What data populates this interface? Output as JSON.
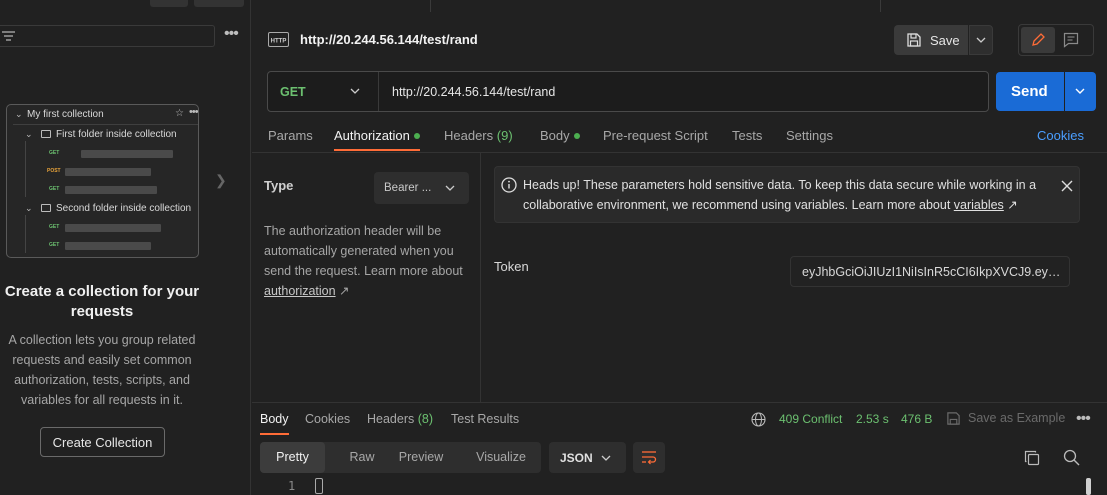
{
  "sidebar": {
    "preview": {
      "collection": "My first collection",
      "folders": [
        {
          "name": "First folder inside collection",
          "requests": [
            "GET",
            "POST",
            "GET"
          ]
        },
        {
          "name": "Second folder inside collection",
          "requests": [
            "GET",
            "GET"
          ]
        }
      ]
    },
    "title": "Create a collection for your requests",
    "description": "A collection lets you group related requests and easily set common authorization, tests, scripts, and variables for all requests in it.",
    "create_button": "Create Collection"
  },
  "request": {
    "title": "http://20.244.56.144/test/rand",
    "save_label": "Save",
    "method": "GET",
    "url": "http://20.244.56.144/test/rand",
    "send_label": "Send"
  },
  "request_tabs": {
    "params": "Params",
    "authorization": "Authorization",
    "headers": "Headers",
    "headers_count": "(9)",
    "body": "Body",
    "pre_request": "Pre-request Script",
    "tests": "Tests",
    "settings": "Settings",
    "cookies": "Cookies"
  },
  "auth": {
    "type_label": "Type",
    "type_value": "Bearer ...",
    "desc_prefix": "The authorization header will be automatically generated when you send the request. Learn more about ",
    "desc_link": "authorization",
    "desc_suffix": " ↗",
    "alert_text": "Heads up! These parameters hold sensitive data. To keep this data secure while working in a collaborative environment, we recommend using variables. Learn more about ",
    "alert_link": "variables",
    "alert_suffix": " ↗",
    "token_label": "Token",
    "token_value": "eyJhbGciOiJIUzI1NiIsInR5cCI6IkpXVCJ9.eyJ..."
  },
  "response": {
    "tabs": {
      "body": "Body",
      "cookies": "Cookies",
      "headers": "Headers",
      "headers_count": "(8)",
      "test_results": "Test Results"
    },
    "status": "409 Conflict",
    "time": "2.53 s",
    "size": "476 B",
    "save_example": "Save as Example",
    "formats": [
      "Pretty",
      "Raw",
      "Preview",
      "Visualize"
    ],
    "active_format": "Pretty",
    "language": "JSON",
    "line_number": "1"
  },
  "colors": {
    "accent": "#ff6c37",
    "send": "#1a6bd6",
    "status_ok": "#6cc070",
    "link": "#4a9eff"
  }
}
